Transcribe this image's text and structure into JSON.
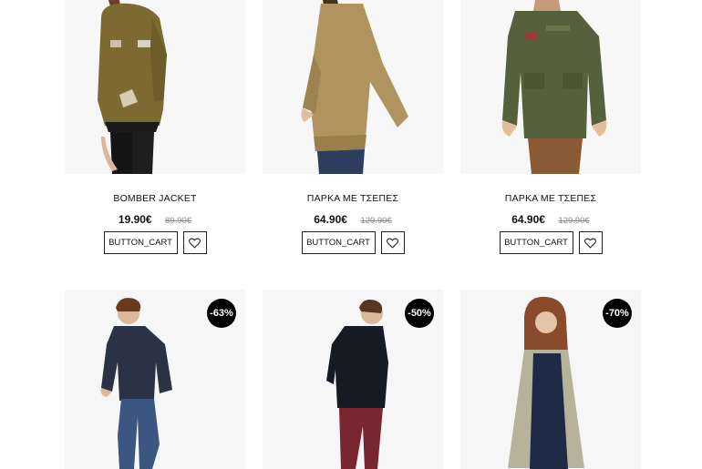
{
  "products_top": [
    {
      "name": "BOMBER JACKET",
      "price": "19.90€",
      "old_price": "89.90€",
      "cart_label": "BUTTON_CART",
      "image": "bomber-jacket-photo"
    },
    {
      "name": "ΠΑΡΚΑ ΜΕ ΤΣΕΠΕΣ",
      "price": "64.90€",
      "old_price": "129.90€",
      "cart_label": "BUTTON_CART",
      "image": "parka-beige-photo"
    },
    {
      "name": "ΠΑΡΚΑ ΜΕ ΤΣΕΠΕΣ",
      "price": "64.90€",
      "old_price": "129.90€",
      "cart_label": "BUTTON_CART",
      "image": "parka-olive-photo"
    }
  ],
  "products_bottom": [
    {
      "badge": "-63%",
      "image": "cardigan-man-photo"
    },
    {
      "badge": "-50%",
      "image": "black-sweater-man-photo"
    },
    {
      "badge": "-70%",
      "image": "long-cardigan-woman-photo"
    }
  ],
  "colors": {
    "badge_bg": "#000000",
    "badge_text": "#ffffff",
    "old_price": "#888888"
  }
}
